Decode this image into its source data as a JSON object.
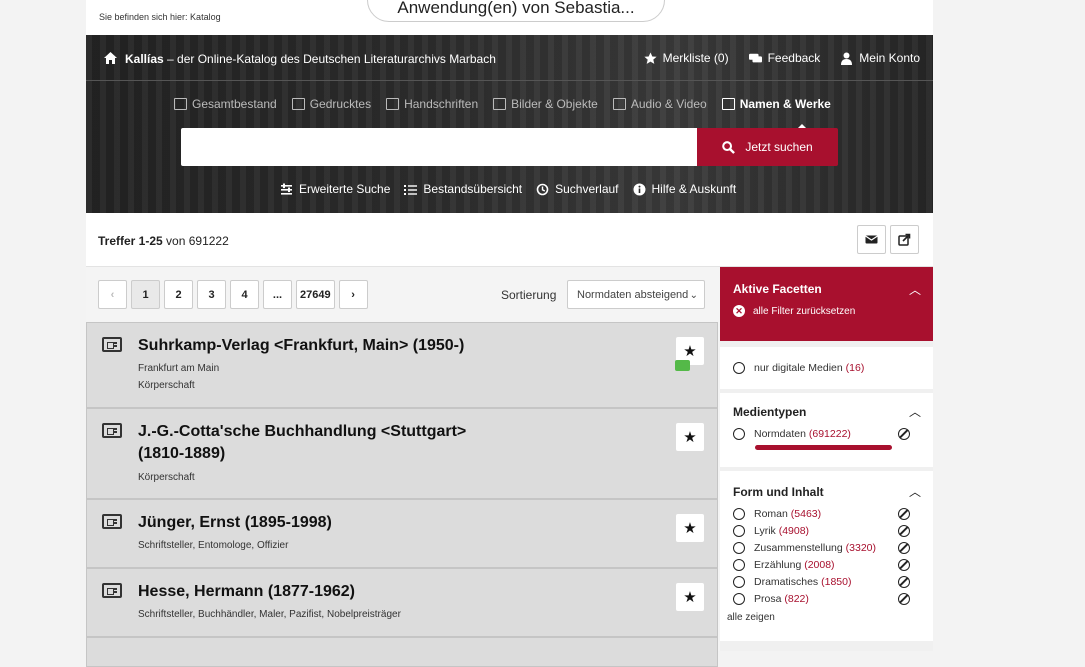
{
  "breadcrumb": "Sie befinden sich hier: Katalog",
  "overlay_pill": "Anwendung(en) von Sebastia...",
  "header": {
    "brand": "Kallías",
    "tagline": " – der Online-Katalog des Deutschen Literaturarchivs Marbach",
    "merkliste": "Merkliste (0)",
    "feedback": "Feedback",
    "konto": "Mein Konto"
  },
  "categories": [
    "Gesamtbestand",
    "Gedrucktes",
    "Handschriften",
    "Bilder & Objekte",
    "Audio & Video",
    "Namen & Werke"
  ],
  "search": {
    "button": "Jetzt suchen",
    "placeholder": ""
  },
  "tools": [
    "Erweiterte Suche",
    "Bestandsübersicht",
    "Suchverlauf",
    "Hilfe & Auskunft"
  ],
  "results": {
    "range": "Treffer 1-25",
    "of": "von 691222"
  },
  "pager": [
    "1",
    "2",
    "3",
    "4",
    "...",
    "27649"
  ],
  "sort": {
    "label": "Sortierung",
    "value": "Normdaten absteigend"
  },
  "records": [
    {
      "title": "Suhrkamp-Verlag <Frankfurt, Main> (1950-)",
      "sub1": "Frankfurt am Main",
      "sub2": "Körperschaft"
    },
    {
      "title": "J.-G.-Cotta'sche Buchhandlung <Stuttgart>",
      "title2": "(1810-1889)",
      "sub1": "Körperschaft"
    },
    {
      "title": "Jünger, Ernst (1895-1998)",
      "sub1": "Schriftsteller, Entomologe, Offizier"
    },
    {
      "title": "Hesse, Hermann (1877-1962)",
      "sub1": "Schriftsteller, Buchhändler, Maler, Pazifist, Nobelpreisträger"
    }
  ],
  "facets": {
    "active_title": "Aktive Facetten",
    "reset": "alle Filter zurücksetzen",
    "digital": {
      "label": "nur digitale Medien",
      "count": "(16)"
    },
    "medientypen": {
      "title": "Medientypen",
      "label": "Normdaten",
      "count": "(691222)"
    },
    "form": {
      "title": "Form und Inhalt",
      "options": [
        {
          "label": "Roman",
          "count": "(5463)"
        },
        {
          "label": "Lyrik",
          "count": "(4908)"
        },
        {
          "label": "Zusammenstellung",
          "count": "(3320)"
        },
        {
          "label": "Erzählung",
          "count": "(2008)"
        },
        {
          "label": "Dramatisches",
          "count": "(1850)"
        },
        {
          "label": "Prosa",
          "count": "(822)"
        }
      ],
      "show_all": "alle zeigen"
    }
  },
  "colors": {
    "accent": "#a8102e",
    "hero": "#2b2b2b"
  }
}
